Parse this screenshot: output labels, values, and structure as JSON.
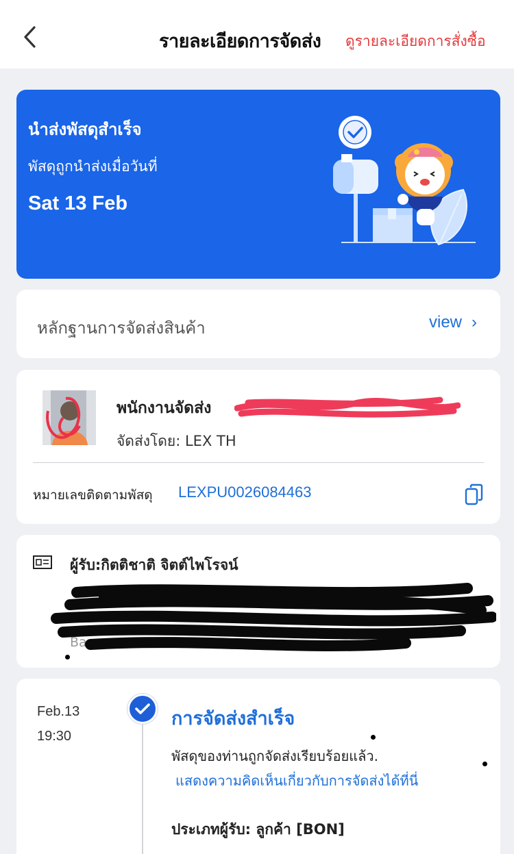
{
  "header": {
    "title": "รายละเอียดการจัดส่ง",
    "order_link": "ดูรายละเอียดการสั่งซื้อ"
  },
  "hero": {
    "title": "นำส่งพัสดุสำเร็จ",
    "subtitle": "พัสดุถูกนำส่งเมื่อวันที่",
    "date": "Sat 13 Feb"
  },
  "proof": {
    "label": "หลักฐานการจัดส่งสินค้า",
    "view": "view"
  },
  "courier": {
    "name": "พนักงานจัดส่ง",
    "by": "จัดส่งโดย: LEX TH",
    "tracking_label": "หมายเลขติดตามพัสดุ",
    "tracking_number": "LEXPU0026084463"
  },
  "recipient": {
    "name": "ผู้รับ:กิตติชาติ จิตต์ไพโรจน์",
    "address_end": "Ba"
  },
  "timeline": {
    "date": "Feb.13",
    "time": "19:30",
    "title": "การจัดส่งสำเร็จ",
    "description": "พัสดุของท่านถูกจัดส่งเรียบร้อยแล้ว.",
    "feedback_link": "แสดงความคิดเห็นเกี่ยวกับการจัดส่งได้ที่นี่",
    "recipient_type": "ประเภทผู้รับ: ลูกค้า [BON]"
  },
  "colors": {
    "hero_bg": "#1a65e8",
    "link_blue": "#1e6fd9",
    "accent_red": "#e5383b",
    "page_bg": "#eff0f4"
  },
  "icons": [
    "back-chevron-icon",
    "delivery-mailbox-illustration",
    "chevron-right-icon",
    "copy-icon",
    "id-card-icon",
    "check-circle-icon"
  ]
}
